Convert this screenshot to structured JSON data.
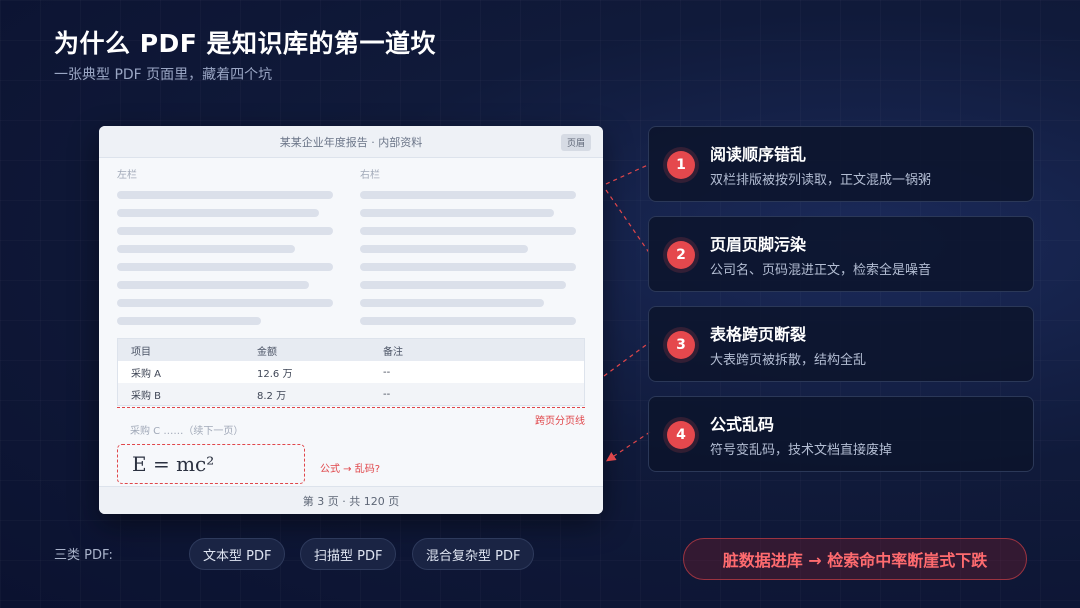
{
  "title": "为什么 PDF 是知识库的第一道坎",
  "subtitle": "一张典型 PDF 页面里，藏着四个坑",
  "doc": {
    "header": "某某企业年度报告 · 内部资料",
    "badge": "页眉",
    "left_label": "左栏",
    "right_label": "右栏",
    "table": {
      "headers": [
        "项目",
        "金额",
        "备注"
      ],
      "rows": [
        [
          "采购 A",
          "12.6 万",
          "--"
        ],
        [
          "采购 B",
          "8.2 万",
          "--"
        ]
      ],
      "continued": "采购 C ……（续下一页）"
    },
    "split_label": "跨页分页线",
    "formula": "E = mc²",
    "formula_note": "公式 → 乱码?",
    "footer": "第 3 页 · 共 120 页"
  },
  "issues": [
    {
      "num": "1",
      "title": "阅读顺序错乱",
      "desc": "双栏排版被按列读取，正文混成一锅粥"
    },
    {
      "num": "2",
      "title": "页眉页脚污染",
      "desc": "公司名、页码混进正文，检索全是噪音"
    },
    {
      "num": "3",
      "title": "表格跨页断裂",
      "desc": "大表跨页被拆散，结构全乱"
    },
    {
      "num": "4",
      "title": "公式乱码",
      "desc": "符号变乱码，技术文档直接废掉"
    }
  ],
  "types": {
    "label": "三类 PDF:",
    "items": [
      "文本型 PDF",
      "扫描型 PDF",
      "混合复杂型 PDF"
    ]
  },
  "warning": "脏数据进库 → 检索命中率断崖式下跌",
  "colors": {
    "accent_red": "#e5484d",
    "background": "#0b1230",
    "card_border": "#2b3858"
  }
}
